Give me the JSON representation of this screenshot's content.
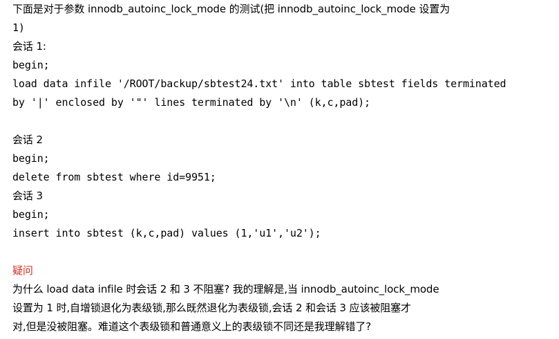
{
  "intro": {
    "line1": "下面是对于参数 innodb_autoinc_lock_mode 的测试(把 innodb_autoinc_lock_mode 设置为",
    "line2": "1)"
  },
  "session1": {
    "title": "会话 1:",
    "lines": [
      "begin;",
      "load data infile '/ROOT/backup/sbtest24.txt' into table sbtest fields terminated",
      "by '|' enclosed by '\"' lines terminated by '\\n' (k,c,pad);"
    ]
  },
  "session2": {
    "title": "会话 2",
    "lines": [
      "begin;",
      "delete from sbtest where id=9951;"
    ]
  },
  "session3": {
    "title": "会话 3",
    "lines": [
      "begin;",
      "insert into sbtest (k,c,pad) values (1,'u1','u2');"
    ]
  },
  "question": {
    "label": "疑问",
    "lines": [
      "为什么 load data infile 时会话 2 和 3 不阻塞? 我的理解是,当 innodb_autoinc_lock_mode",
      "设置为 1 时,自增锁退化为表级锁,那么既然退化为表级锁,会话 2 和会话 3 应该被阻塞才",
      "对,但是没被阻塞。难道这个表级锁和普通意义上的表级锁不同还是我理解错了?"
    ]
  },
  "colors": {
    "question_label": "#e0281a",
    "text": "#000000",
    "background": "#ffffff"
  }
}
